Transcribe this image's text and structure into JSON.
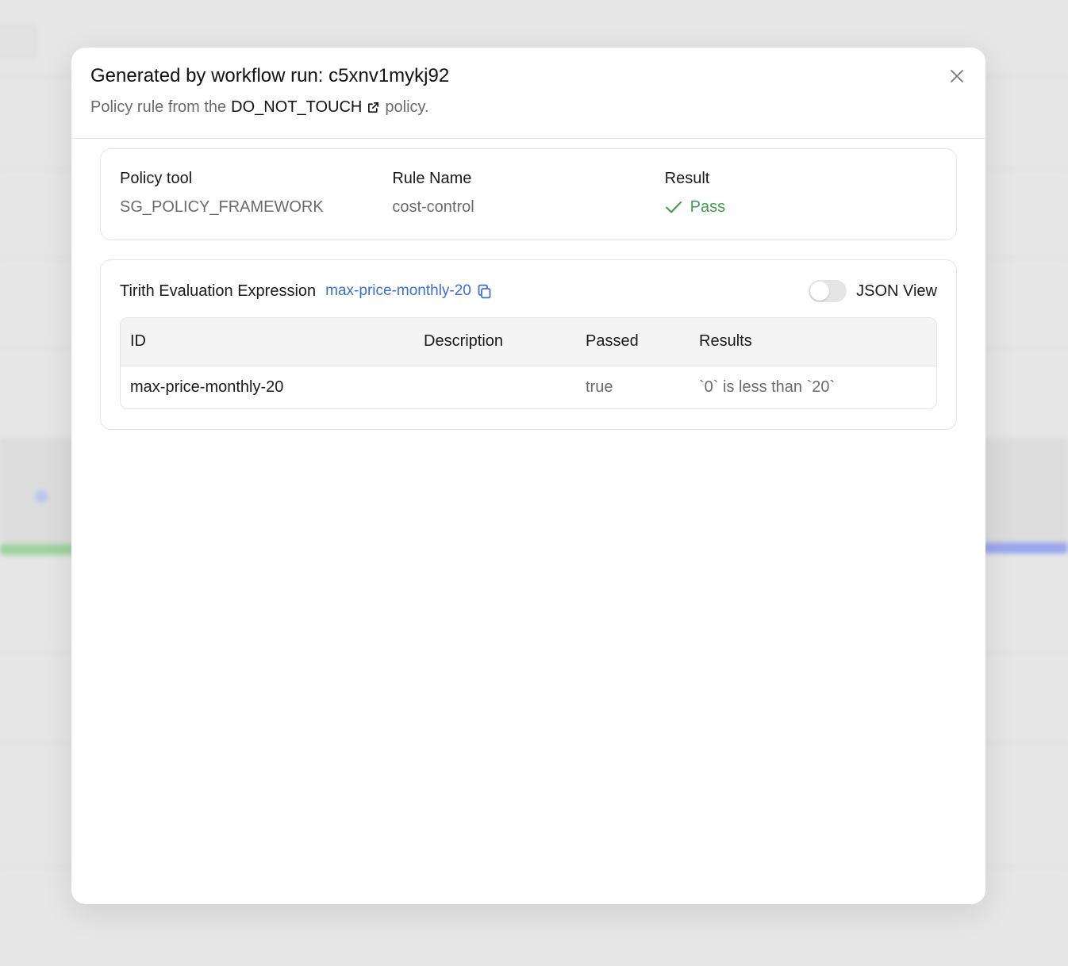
{
  "modal": {
    "title": "Generated by workflow run: c5xnv1mykj92",
    "subtitle_prefix": "Policy rule from the",
    "policy_name": "DO_NOT_TOUCH",
    "subtitle_suffix": "policy."
  },
  "info": {
    "policy_tool_label": "Policy tool",
    "policy_tool_value": "SG_POLICY_FRAMEWORK",
    "rule_name_label": "Rule Name",
    "rule_name_value": "cost-control",
    "result_label": "Result",
    "result_value": "Pass"
  },
  "expression": {
    "label": "Tirith Evaluation Expression",
    "link": "max-price-monthly-20",
    "json_view_label": "JSON View",
    "json_view_on": false
  },
  "table": {
    "headers": [
      "ID",
      "Description",
      "Passed",
      "Results"
    ],
    "rows": [
      [
        "max-price-monthly-20",
        "",
        "true",
        "`0` is less than `20`"
      ]
    ]
  },
  "colors": {
    "pass": "#3f9a4d",
    "link": "#3b6fd8"
  },
  "icons": [
    "external-link-icon",
    "close-icon",
    "check-icon",
    "copy-icon"
  ]
}
